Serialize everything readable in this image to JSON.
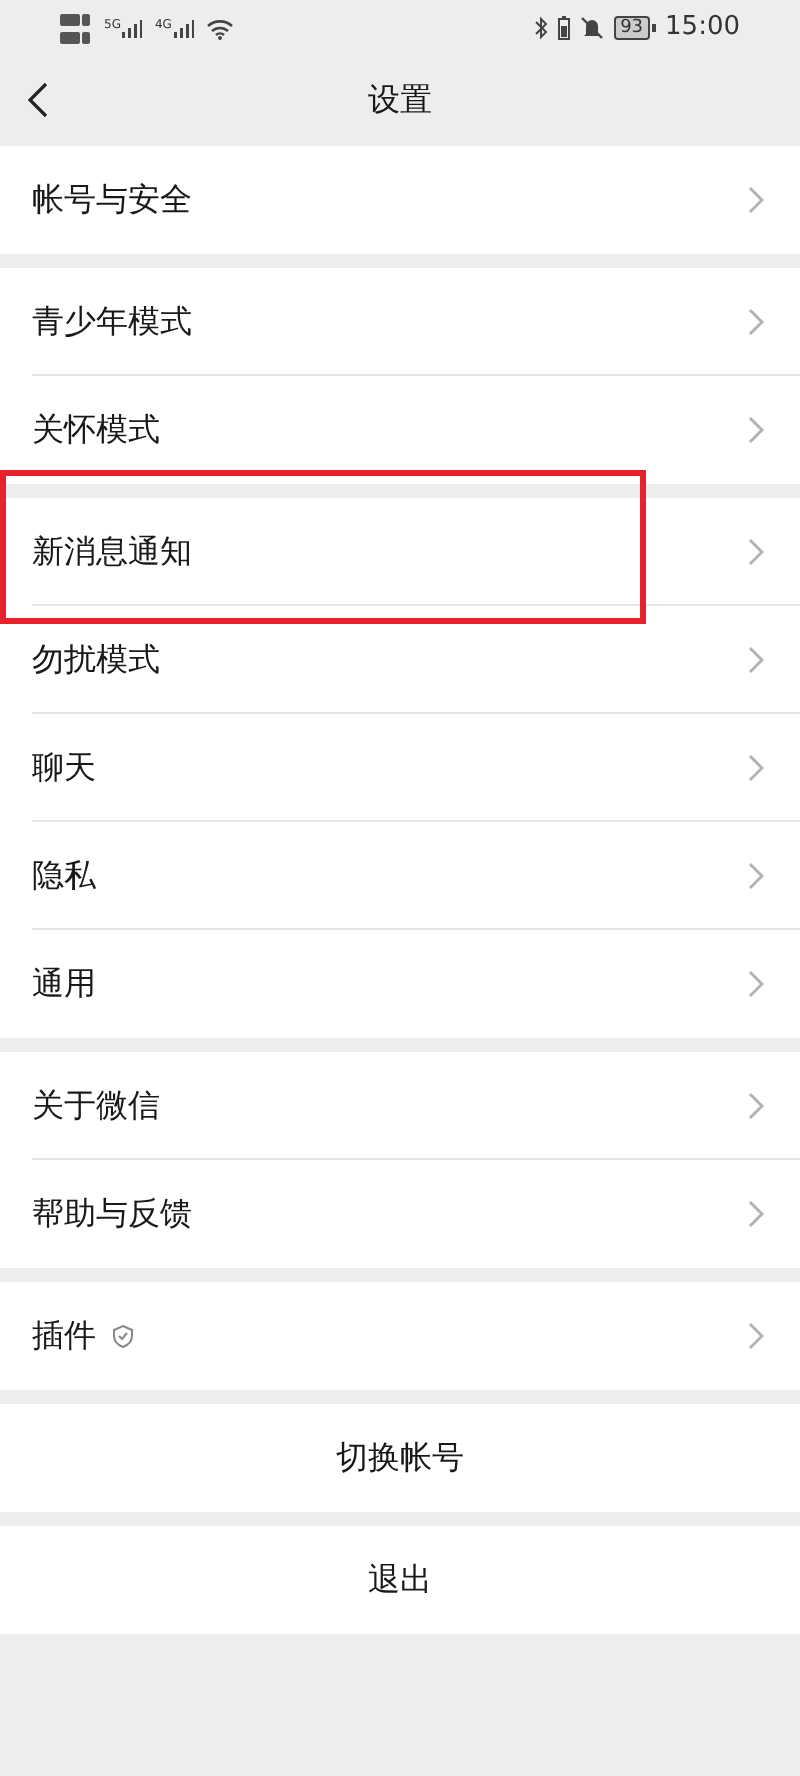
{
  "status_bar": {
    "network_1": "5G",
    "network_2": "4G",
    "battery": "93",
    "time": "15:00"
  },
  "header": {
    "title": "设置"
  },
  "groups": [
    {
      "items": [
        {
          "label": "帐号与安全",
          "kind": "link",
          "highlighted": false
        }
      ]
    },
    {
      "items": [
        {
          "label": "青少年模式",
          "kind": "link",
          "highlighted": false
        },
        {
          "label": "关怀模式",
          "kind": "link",
          "highlighted": false
        }
      ]
    },
    {
      "items": [
        {
          "label": "新消息通知",
          "kind": "link",
          "highlighted": true
        },
        {
          "label": "勿扰模式",
          "kind": "link",
          "highlighted": false
        },
        {
          "label": "聊天",
          "kind": "link",
          "highlighted": false
        },
        {
          "label": "隐私",
          "kind": "link",
          "highlighted": false
        },
        {
          "label": "通用",
          "kind": "link",
          "highlighted": false
        }
      ]
    },
    {
      "items": [
        {
          "label": "关于微信",
          "kind": "link",
          "highlighted": false
        },
        {
          "label": "帮助与反馈",
          "kind": "link",
          "highlighted": false
        }
      ]
    },
    {
      "items": [
        {
          "label": "插件",
          "kind": "link_badge",
          "highlighted": false
        }
      ]
    },
    {
      "items": [
        {
          "label": "切换帐号",
          "kind": "action",
          "highlighted": false
        }
      ]
    },
    {
      "items": [
        {
          "label": "退出",
          "kind": "action",
          "highlighted": false
        }
      ]
    }
  ]
}
